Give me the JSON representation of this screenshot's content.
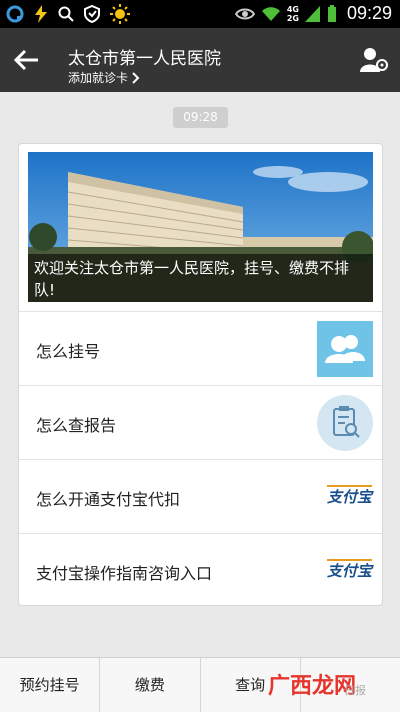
{
  "status_bar": {
    "time": "09:29",
    "network_a": "4G",
    "network_b": "2G"
  },
  "nav": {
    "title": "太仓市第一人民医院",
    "subtitle": "添加就诊卡"
  },
  "timestamp": "09:28",
  "banner": {
    "caption": "欢迎关注太仓市第一人民医院，挂号、缴费不排队!"
  },
  "menu_items": [
    {
      "label": "怎么挂号",
      "thumb": "user-group-icon"
    },
    {
      "label": "怎么查报告",
      "thumb": "clipboard-search-icon"
    },
    {
      "label": "怎么开通支付宝代扣",
      "thumb": "alipay-logo"
    },
    {
      "label": "支付宝操作指南咨询入口",
      "thumb": "alipay-logo"
    }
  ],
  "alipay_logo_text": "支付宝",
  "tabs": [
    {
      "label": "预约挂号"
    },
    {
      "label": "缴费"
    },
    {
      "label": "查询"
    },
    {
      "label": ""
    }
  ],
  "watermark": "广西龙网",
  "watermark_small": "日报",
  "colors": {
    "nav_bg": "#353535",
    "thumb_blue": "#6ec3e6",
    "alipay_blue": "#1a4f8c",
    "watermark_red": "#e5352d"
  }
}
